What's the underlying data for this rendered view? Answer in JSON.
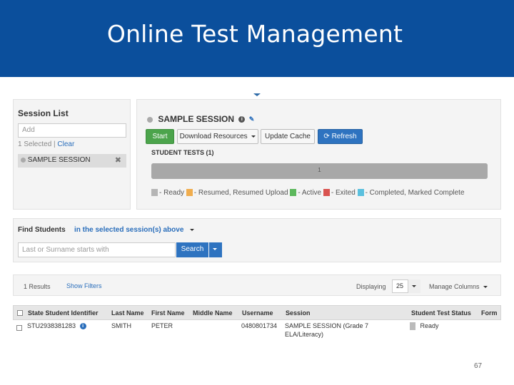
{
  "slide": {
    "title": "Online Test Management",
    "page_number": "67"
  },
  "session_list": {
    "title": "Session List",
    "add_placeholder": "Add",
    "selected_text": "1 Selected |",
    "clear_link": "Clear",
    "item": "SAMPLE SESSION",
    "remove": "✖"
  },
  "session_detail": {
    "title": "SAMPLE SESSION",
    "buttons": {
      "start": "Start",
      "download": "Download Resources",
      "update": "Update Cache",
      "refresh": "Refresh"
    },
    "student_tests": "STUDENT TESTS (1)",
    "progress": {
      "count": "1",
      "ready_fraction": 1.0
    },
    "legend": [
      {
        "label": "- Ready",
        "color": "#b5b5b5"
      },
      {
        "label": "- Resumed, Resumed Upload",
        "color": "#f0ad4e"
      },
      {
        "label": "- Active",
        "color": "#5cb85c"
      },
      {
        "label": "- Exited",
        "color": "#d9534f"
      },
      {
        "label": "- Completed, Marked Complete",
        "color": "#5bc0de"
      }
    ]
  },
  "find_students": {
    "title": "Find Students",
    "scope": "in the selected session(s) above",
    "input_placeholder": "Last or Surname starts with",
    "search_button": "Search"
  },
  "results": {
    "count": "1 Results",
    "show_filters": "Show Filters",
    "displaying_label": "Displaying",
    "displaying_value": "25",
    "manage_columns": "Manage Columns"
  },
  "table": {
    "headers": [
      "State Student Identifier",
      "Last Name",
      "First Name",
      "Middle Name",
      "Username",
      "Session",
      "Student Test Status",
      "Form"
    ],
    "rows": [
      {
        "id": "STU2938381283",
        "last": "SMITH",
        "first": "PETER",
        "middle": "",
        "username": "0480801734",
        "session_line1": "SAMPLE SESSION (Grade 7",
        "session_line2": "ELA/Literacy)",
        "status": "Ready",
        "form": ""
      }
    ]
  }
}
